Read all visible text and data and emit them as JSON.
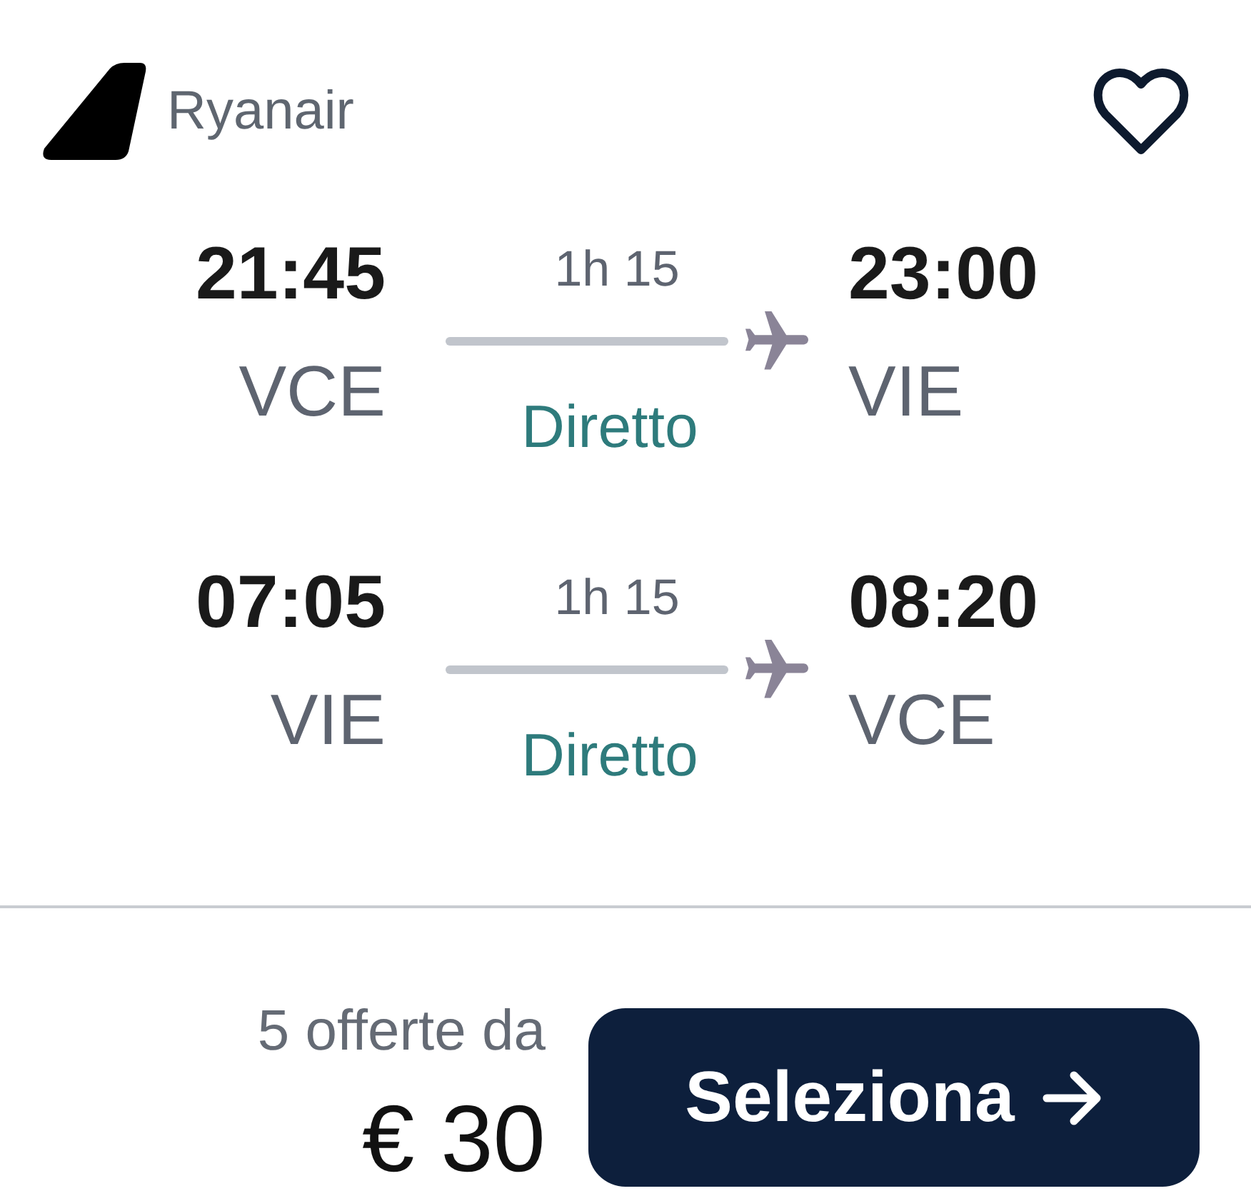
{
  "header": {
    "airline": "Ryanair",
    "favorite": false
  },
  "legs": [
    {
      "departure_time": "21:45",
      "departure_airport": "VCE",
      "duration": "1h 15",
      "stops": "Diretto",
      "arrival_time": "23:00",
      "arrival_airport": "VIE"
    },
    {
      "departure_time": "07:05",
      "departure_airport": "VIE",
      "duration": "1h 15",
      "stops": "Diretto",
      "arrival_time": "08:20",
      "arrival_airport": "VCE"
    }
  ],
  "footer": {
    "offers": "5 offerte da",
    "price": "€ 30",
    "button": "Seleziona"
  }
}
